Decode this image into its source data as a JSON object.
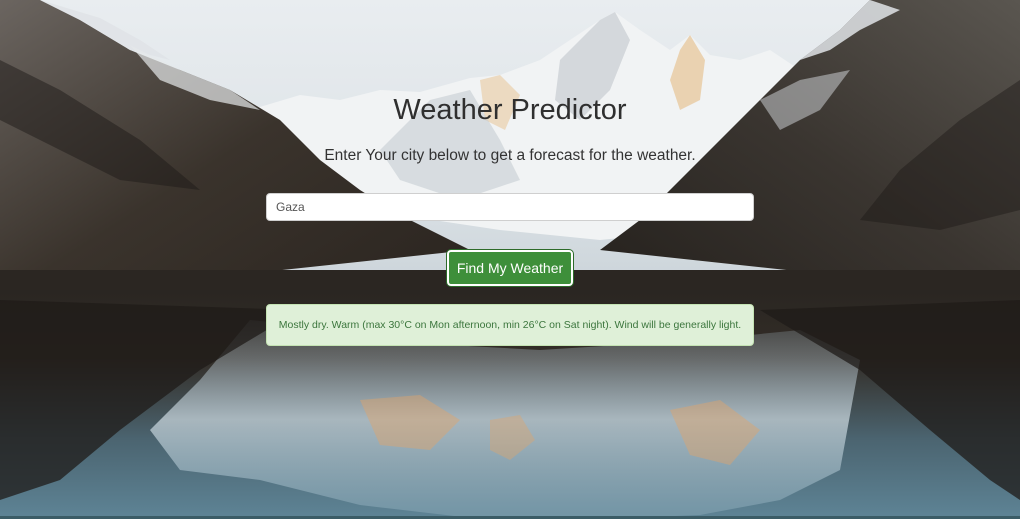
{
  "page": {
    "title": "Weather Predictor",
    "subtitle": "Enter Your city below to get a forecast for the weather."
  },
  "search": {
    "value": "Gaza",
    "placeholder": ""
  },
  "actions": {
    "find_label": "Find My Weather"
  },
  "result": {
    "text": "Mostly dry. Warm (max 30°C on Mon afternoon, min 26°C on Sat night). Wind will be generally light."
  },
  "colors": {
    "button": "#3e8f3a",
    "alert_bg": "#dff0d8",
    "alert_text": "#3c763d"
  }
}
